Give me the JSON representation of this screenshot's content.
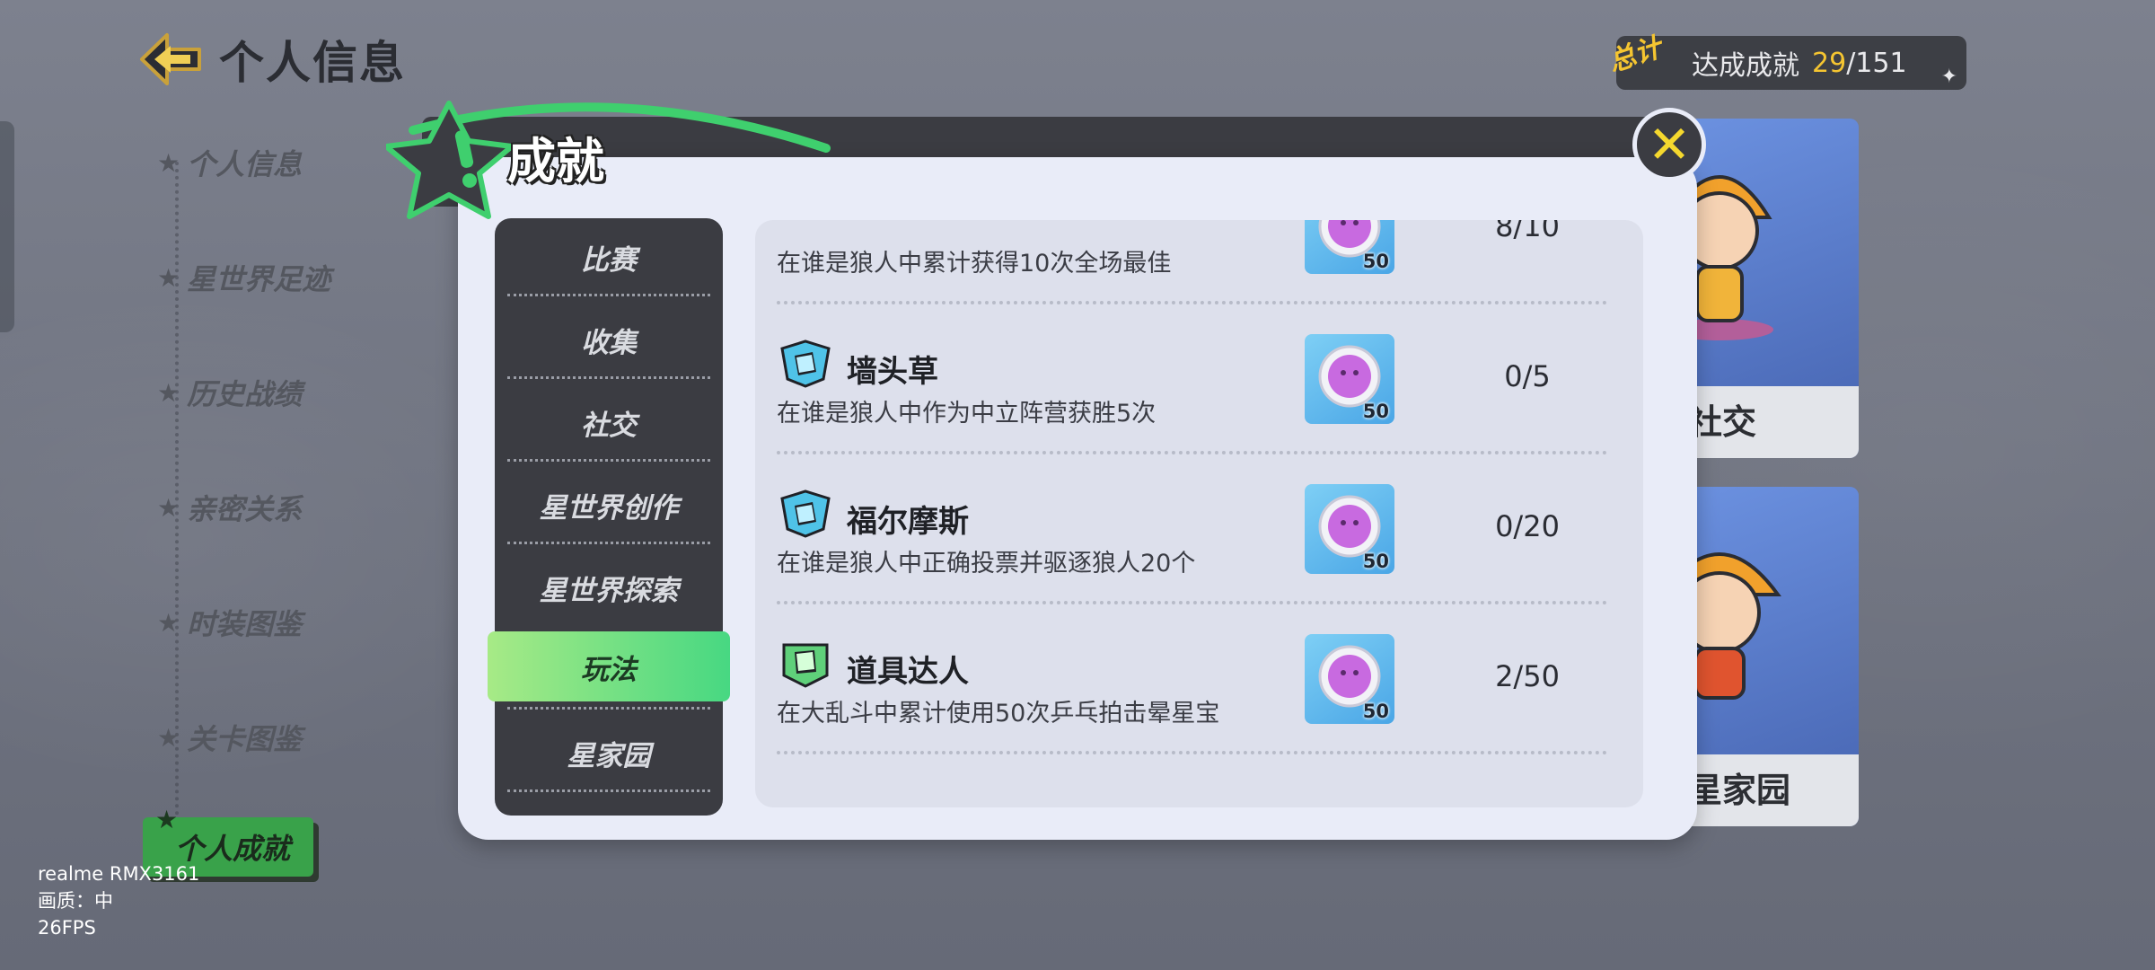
{
  "page": {
    "title": "个人信息"
  },
  "side_menu": {
    "items": [
      {
        "label": "个人信息"
      },
      {
        "label": "星世界足迹"
      },
      {
        "label": "历史战绩"
      },
      {
        "label": "亲密关系"
      },
      {
        "label": "时装图鉴"
      },
      {
        "label": "关卡图鉴"
      },
      {
        "label": "个人成就",
        "active": true
      }
    ]
  },
  "total": {
    "tag": "总计",
    "label": "达成成就",
    "achieved": "29",
    "separator": "/",
    "max": "151"
  },
  "right_cards": [
    {
      "label": "社交"
    },
    {
      "label": "星家园"
    }
  ],
  "modal": {
    "title": "成就",
    "close_icon": "close-x-icon",
    "categories": [
      {
        "label": "比赛"
      },
      {
        "label": "收集"
      },
      {
        "label": "社交"
      },
      {
        "label": "星世界创作"
      },
      {
        "label": "星世界探索"
      },
      {
        "label": "玩法",
        "active": true
      },
      {
        "label": "星家园"
      }
    ],
    "achievements": [
      {
        "name": "",
        "description": "在谁是狼人中累计获得10次全场最佳",
        "reward_amount": "50",
        "progress": "8/10",
        "badge_color": "#4fc3e8"
      },
      {
        "name": "墙头草",
        "description": "在谁是狼人中作为中立阵营获胜5次",
        "reward_amount": "50",
        "progress": "0/5",
        "badge_color": "#4fc3e8"
      },
      {
        "name": "福尔摩斯",
        "description": "在谁是狼人中正确投票并驱逐狼人20个",
        "reward_amount": "50",
        "progress": "0/20",
        "badge_color": "#4fc3e8"
      },
      {
        "name": "道具达人",
        "description": "在大乱斗中累计使用50次乒乓拍击晕星宝",
        "reward_amount": "50",
        "progress": "2/50",
        "badge_color": "#5fd07a"
      }
    ]
  },
  "device": {
    "model": "realme RMX3161",
    "quality": "画质：中",
    "fps": "26FPS"
  },
  "colors": {
    "accent_green": "#47d882",
    "gold": "#f5c531",
    "close_yellow": "#f5d82e",
    "panel_dark": "#3b3c42"
  }
}
